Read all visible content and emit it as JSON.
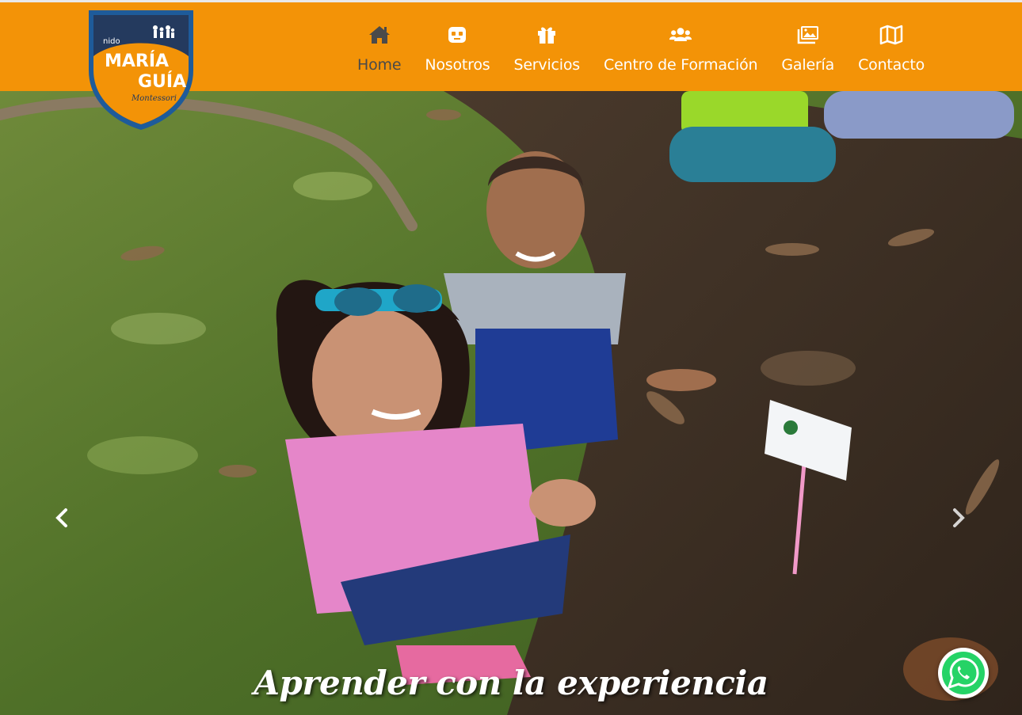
{
  "brand": {
    "small": "nido",
    "line1": "MARÍA",
    "line2": "GUÍA",
    "tagline": "Montessori",
    "color_primary": "#f39307",
    "color_shield": "#1e5b9a"
  },
  "nav": {
    "items": [
      {
        "label": "Home",
        "icon": "home-icon",
        "active": true
      },
      {
        "label": "Nosotros",
        "icon": "robot-face-icon",
        "active": false
      },
      {
        "label": "Servicios",
        "icon": "gift-icon",
        "active": false
      },
      {
        "label": "Centro de Formación",
        "icon": "users-icon",
        "active": false
      },
      {
        "label": "Galería",
        "icon": "images-icon",
        "active": false
      },
      {
        "label": "Contacto",
        "icon": "map-icon",
        "active": false
      }
    ]
  },
  "hero": {
    "caption": "Aprender con la experiencia",
    "prev_icon": "chevron-left-icon",
    "next_icon": "chevron-right-icon"
  },
  "whatsapp": {
    "icon": "whatsapp-icon",
    "color": "#25d366"
  }
}
